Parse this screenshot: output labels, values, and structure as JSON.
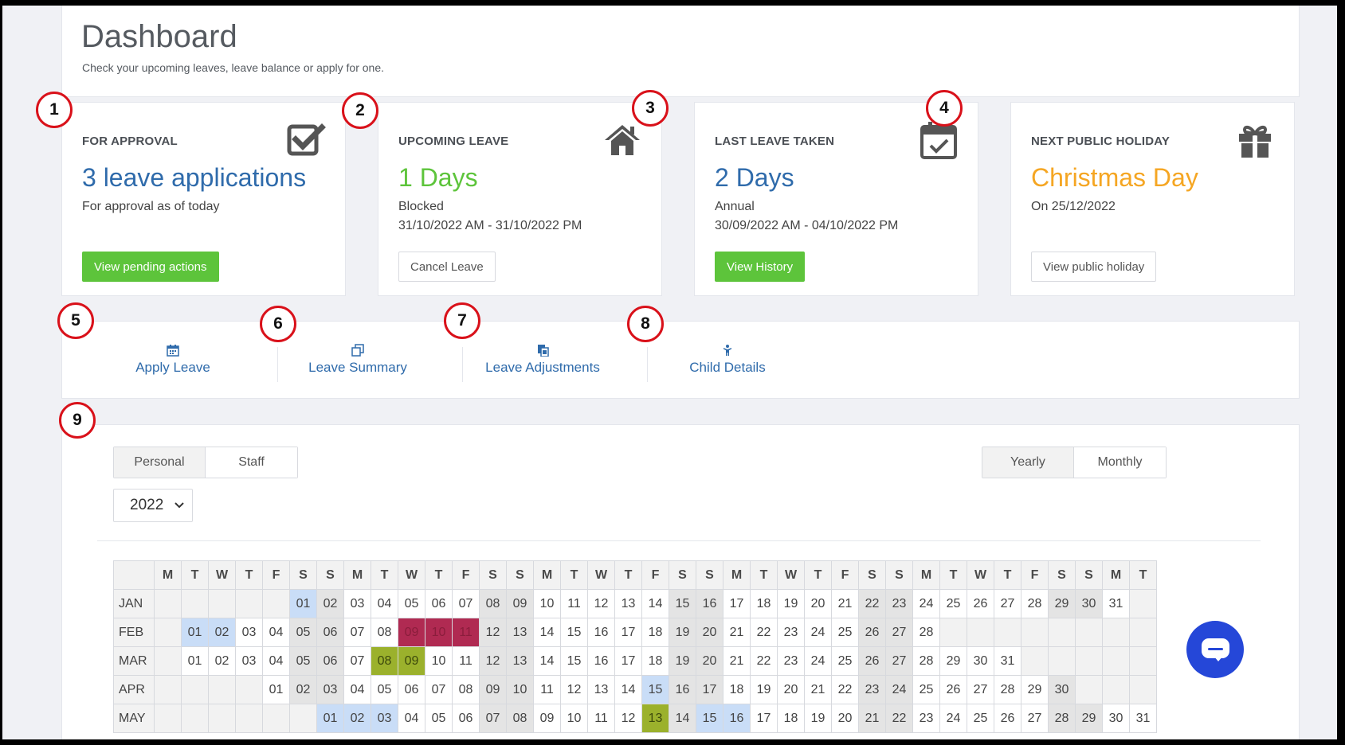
{
  "header": {
    "title": "Dashboard",
    "subtitle": "Check your upcoming leaves, leave balance or apply for one."
  },
  "cards": {
    "approval": {
      "title": "FOR APPROVAL",
      "value": "3 leave applications",
      "value_color": "#2f6bab",
      "line1": "For approval as of today",
      "button": "View pending actions",
      "icon": "checkbox-check-icon"
    },
    "upcoming": {
      "title": "UPCOMING LEAVE",
      "value": "1 Days",
      "value_color": "#5dc43b",
      "line1": "Blocked",
      "line2": "31/10/2022 AM - 31/10/2022 PM",
      "button": "Cancel Leave",
      "icon": "home-icon"
    },
    "last": {
      "title": "LAST LEAVE TAKEN",
      "value": "2 Days",
      "value_color": "#2f6bab",
      "line1": "Annual",
      "line2": "30/09/2022 AM - 04/10/2022 PM",
      "button": "View History",
      "icon": "calendar-check-icon"
    },
    "holiday": {
      "title": "NEXT PUBLIC HOLIDAY",
      "value": "Christmas Day",
      "value_color": "#f5a623",
      "line1": "On 25/12/2022",
      "button": "View public holiday",
      "icon": "gift-icon"
    }
  },
  "shortcuts": [
    {
      "label": "Apply Leave",
      "icon": "calendar-icon"
    },
    {
      "label": "Leave Summary",
      "icon": "copy-icon"
    },
    {
      "label": "Leave Adjustments",
      "icon": "files-icon"
    },
    {
      "label": "Child Details",
      "icon": "child-icon"
    }
  ],
  "calendar": {
    "view_toggle": [
      "Personal",
      "Staff"
    ],
    "period_toggle": [
      "Yearly",
      "Monthly"
    ],
    "active_view": "Personal",
    "active_period": "Yearly",
    "year": "2022",
    "weekday_headers": [
      "M",
      "T",
      "W",
      "T",
      "F",
      "S",
      "S",
      "M",
      "T",
      "W",
      "T",
      "F",
      "S",
      "S",
      "M",
      "T",
      "W",
      "T",
      "F",
      "S",
      "S",
      "M",
      "T",
      "W",
      "T",
      "F",
      "S",
      "S",
      "M",
      "T",
      "W",
      "T",
      "F",
      "S",
      "S",
      "M",
      "T"
    ],
    "months": [
      {
        "name": "JAN",
        "offset": 5,
        "days": 31,
        "blue": [
          1
        ],
        "red": [],
        "olive": []
      },
      {
        "name": "FEB",
        "offset": 1,
        "days": 28,
        "blue": [
          1,
          2
        ],
        "red": [
          9,
          10,
          11
        ],
        "olive": []
      },
      {
        "name": "MAR",
        "offset": 1,
        "days": 31,
        "blue": [],
        "red": [],
        "olive": [
          8,
          9
        ]
      },
      {
        "name": "APR",
        "offset": 4,
        "days": 30,
        "blue": [
          15
        ],
        "red": [],
        "olive": []
      },
      {
        "name": "MAY",
        "offset": 6,
        "days": 31,
        "blue": [
          1,
          2,
          3,
          15,
          16
        ],
        "red": [],
        "olive": [
          13
        ]
      }
    ],
    "colors": {
      "highlight_blue": "#c9ddf7",
      "leave_red": "#b02a52",
      "leave_olive": "#9bb12c",
      "weekend": "#e4e4e4"
    }
  },
  "markers": [
    "1",
    "2",
    "3",
    "4",
    "5",
    "6",
    "7",
    "8",
    "9"
  ],
  "chat": {
    "icon": "chat-bubble-icon",
    "color": "#2547d8"
  }
}
